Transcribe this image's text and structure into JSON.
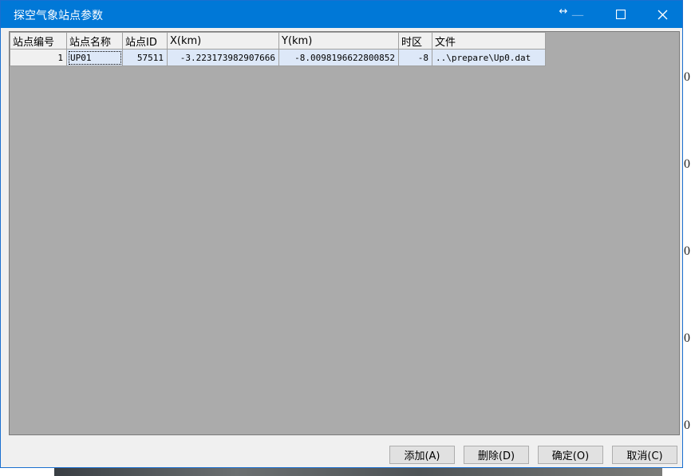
{
  "window": {
    "title": "探空气象站点参数",
    "resize_glyph": "↔",
    "minimize_glyph": "—",
    "maximize_glyph": "☐",
    "close_glyph": "✕"
  },
  "grid": {
    "columns": [
      "站点编号",
      "站点名称",
      "站点ID",
      "X(km)",
      "Y(km)",
      "时区",
      "文件"
    ],
    "rows": [
      {
        "num": "1",
        "name": "UP01",
        "id": "57511",
        "x": "-3.223173982907666",
        "y": "-8.0098196622800852",
        "tz": "-8",
        "file": "..\\prepare\\Up0.dat"
      }
    ]
  },
  "buttons": {
    "add": "添加(A)",
    "delete": "删除(D)",
    "ok": "确定(O)",
    "cancel": "取消(C)"
  },
  "background": {
    "edge_glyphs": [
      "0",
      "0",
      "0",
      "0",
      "0"
    ]
  }
}
